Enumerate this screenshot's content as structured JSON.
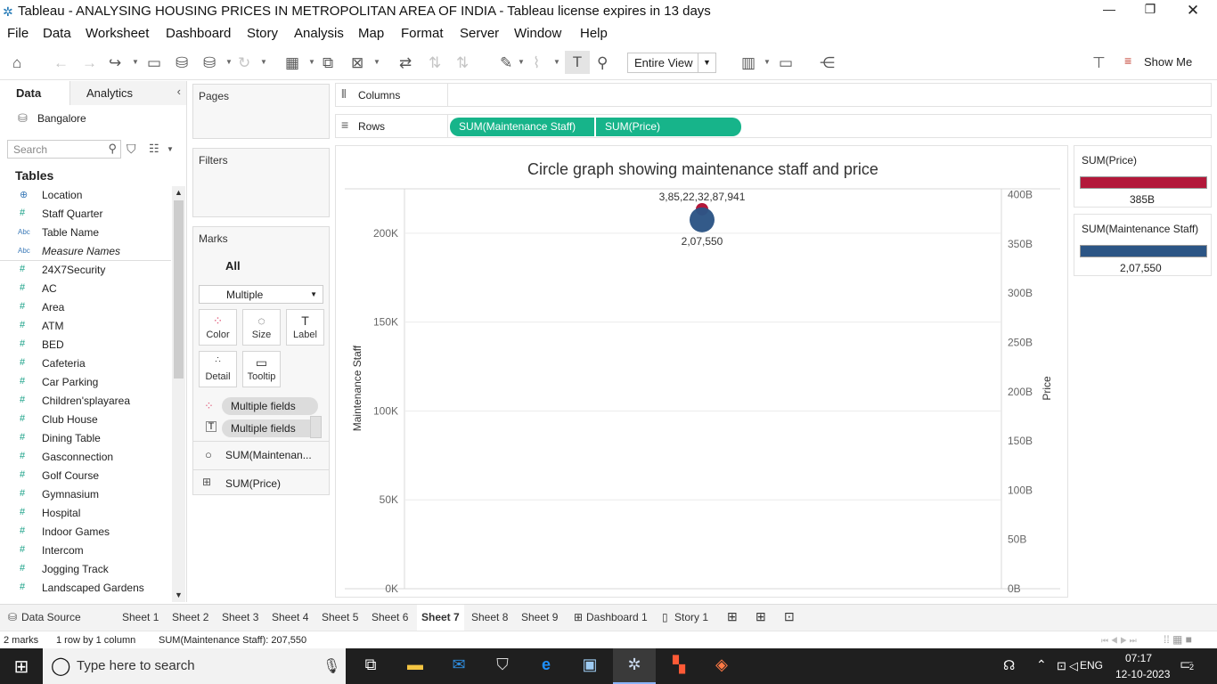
{
  "window": {
    "title": "Tableau - ANALYSING HOUSING PRICES IN METROPOLITAN AREA OF INDIA - Tableau license expires in 13 days"
  },
  "menu": [
    "File",
    "Data",
    "Worksheet",
    "Dashboard",
    "Story",
    "Analysis",
    "Map",
    "Format",
    "Server",
    "Window",
    "Help"
  ],
  "toolbar": {
    "fit_value": "Entire View",
    "show_me_label": "Show Me"
  },
  "side": {
    "tab_data": "Data",
    "tab_analytics": "Analytics",
    "datasource": "Bangalore",
    "search_placeholder": "Search",
    "tables_heading": "Tables",
    "fields": [
      {
        "name": "Location",
        "type": "geo"
      },
      {
        "name": "Staff Quarter",
        "type": "num"
      },
      {
        "name": "Table Name",
        "type": "abc"
      },
      {
        "name": "Measure Names",
        "type": "abc"
      },
      {
        "name": "24X7Security",
        "type": "num"
      },
      {
        "name": "AC",
        "type": "num"
      },
      {
        "name": "Area",
        "type": "num"
      },
      {
        "name": "ATM",
        "type": "num"
      },
      {
        "name": "BED",
        "type": "num"
      },
      {
        "name": "Cafeteria",
        "type": "num"
      },
      {
        "name": "Car Parking",
        "type": "num"
      },
      {
        "name": "Children'splayarea",
        "type": "num"
      },
      {
        "name": "Club House",
        "type": "num"
      },
      {
        "name": "Dining Table",
        "type": "num"
      },
      {
        "name": "Gasconnection",
        "type": "num"
      },
      {
        "name": "Golf Course",
        "type": "num"
      },
      {
        "name": "Gymnasium",
        "type": "num"
      },
      {
        "name": "Hospital",
        "type": "num"
      },
      {
        "name": "Indoor Games",
        "type": "num"
      },
      {
        "name": "Intercom",
        "type": "num"
      },
      {
        "name": "Jogging Track",
        "type": "num"
      },
      {
        "name": "Landscaped Gardens",
        "type": "num"
      }
    ]
  },
  "cards": {
    "pages": "Pages",
    "filters": "Filters",
    "marks": "Marks",
    "marks_all": "All",
    "mark_type": "Multiple",
    "buttons": {
      "color": "Color",
      "size": "Size",
      "label": "Label",
      "detail": "Detail",
      "tooltip": "Tooltip"
    },
    "pills": [
      "Multiple fields",
      "Multiple fields"
    ],
    "measure_maint": "SUM(Maintenan...",
    "measure_price": "SUM(Price)"
  },
  "shelves": {
    "columns_label": "Columns",
    "rows_label": "Rows",
    "rows_pills": [
      "SUM(Maintenance Staff)",
      "SUM(Price)"
    ]
  },
  "chart_data": {
    "type": "scatter",
    "title": "Circle graph showing maintenance staff and price",
    "ylabel_left": "Maintenance Staff",
    "ylabel_right": "Price",
    "left_ticks": [
      "200K",
      "150K",
      "100K",
      "50K",
      "0K"
    ],
    "right_ticks": [
      "400B",
      "350B",
      "300B",
      "250B",
      "200B",
      "150B",
      "100B",
      "50B",
      "0B"
    ],
    "ylim_left": [
      0,
      225000
    ],
    "ylim_right": [
      0,
      406000000000
    ],
    "series": [
      {
        "name": "SUM(Maintenance Staff)",
        "value": 207550,
        "label": "2,07,550",
        "color": "#2c5585"
      },
      {
        "name": "SUM(Price)",
        "value": 385223287941,
        "label": "3,85,22,32,87,941",
        "color": "#b3183a"
      }
    ]
  },
  "legends": [
    {
      "title": "SUM(Price)",
      "value": "385B",
      "color": "#b3183a"
    },
    {
      "title": "SUM(Maintenance Staff)",
      "value": "2,07,550",
      "color": "#2c5585"
    }
  ],
  "sheets": {
    "datasource": "Data Source",
    "tabs": [
      "Sheet 1",
      "Sheet 2",
      "Sheet 3",
      "Sheet 4",
      "Sheet 5",
      "Sheet 6",
      "Sheet 7",
      "Sheet 8",
      "Sheet 9",
      "Dashboard 1",
      "Story 1"
    ],
    "active": "Sheet 7"
  },
  "status": {
    "marks": "2 marks",
    "rows": "1 row by 1 column",
    "sum": "SUM(Maintenance Staff): 207,550"
  },
  "taskbar": {
    "search_placeholder": "Type here to search",
    "lang": "ENG",
    "time": "07:17",
    "date": "12-10-2023",
    "notifications": "2"
  }
}
